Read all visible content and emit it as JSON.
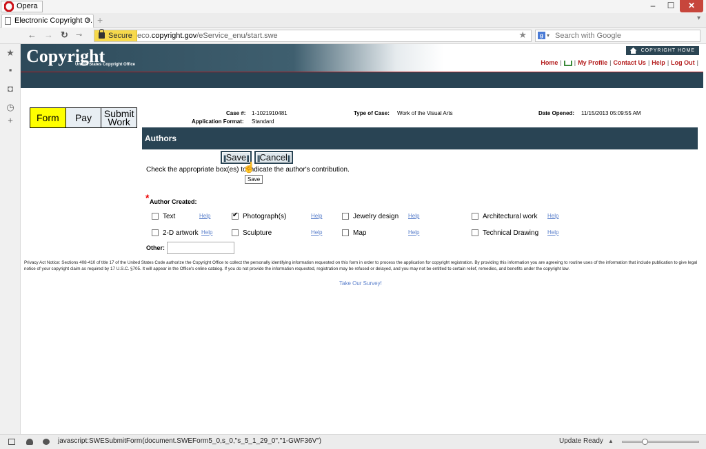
{
  "browser": {
    "menu_label": "Opera",
    "tab_title": "Electronic Copyright O...",
    "tab_close": "×",
    "new_tab": "+",
    "secure_label": "Secure",
    "url_prefix": "eco.",
    "url_domain": "copyright.gov",
    "url_path": "/eService_enu/start.swe",
    "search_placeholder": "Search with Google",
    "status_text": "javascript:SWESubmitForm(document.SWEForm5_0,s_0,\"s_5_1_29_0\",\"1-GWF36V\")",
    "update_ready": "Update Ready",
    "zoom_level": 0.28
  },
  "site": {
    "logo_text": "Copyright",
    "logo_sub": "United States Copyright Office",
    "copyright_home": "COPYRIGHT HOME",
    "top_links": {
      "home": "Home",
      "my_profile": "My Profile",
      "contact_us": "Contact Us",
      "help": "Help",
      "log_out": "Log Out",
      "sep": "|"
    }
  },
  "steps": {
    "form": "Form",
    "pay": "Pay",
    "submit": "Submit Work"
  },
  "case": {
    "case_num_label": "Case #:",
    "case_num": "1-1021910481",
    "app_format_label": "Application Format:",
    "app_format": "Standard",
    "type_label": "Type of Case:",
    "type": "Work of the Visual Arts",
    "date_label": "Date Opened:",
    "date": "11/15/2013 05:09:55 AM"
  },
  "section": {
    "title": "Authors",
    "save": "Save",
    "cancel": "Cancel",
    "tooltip": "Save",
    "instructions": "Check the appropriate box(es) to indicate the author's contribution.",
    "required_star": "*",
    "author_created_label": "Author Created:",
    "other_label": "Other:",
    "other_value": "",
    "help_label": "Help"
  },
  "contributions": [
    {
      "label": "Text",
      "checked": false
    },
    {
      "label": "Photograph(s)",
      "checked": true
    },
    {
      "label": "Jewelry design",
      "checked": false
    },
    {
      "label": "Architectural work",
      "checked": false
    },
    {
      "label": "2-D artwork",
      "checked": false
    },
    {
      "label": "Sculpture",
      "checked": false
    },
    {
      "label": "Map",
      "checked": false
    },
    {
      "label": "Technical Drawing",
      "checked": false
    }
  ],
  "footer": {
    "privacy": "Privacy Act Notice: Sections 408-410 of title 17 of the United States Code authorize the Copyright Office to collect the personally identifying information requested on this form in order to process the application for copyright registration. By providing this information you are agreeing to routine uses of the information that include publication to give legal notice of your copyright claim as required by 17 U.S.C. §705. It will appear in the Office's online catalog. If you do not provide the information requested, registration may be refused or delayed, and you may not be entitled to certain relief, remedies, and benefits under the copyright law.",
    "survey": "Take Our Survey!"
  }
}
